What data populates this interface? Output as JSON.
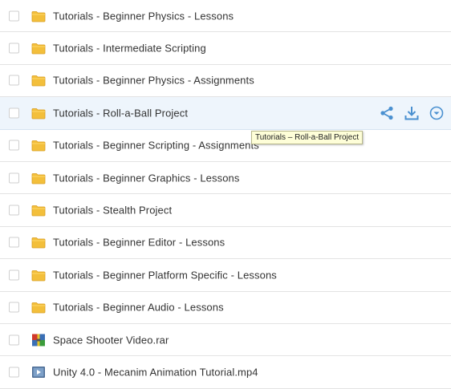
{
  "files": [
    {
      "name": "Tutorials - Beginner Physics - Lessons",
      "type": "folder-icon"
    },
    {
      "name": "Tutorials - Intermediate Scripting",
      "type": "folder-icon"
    },
    {
      "name": "Tutorials - Beginner Physics - Assignments",
      "type": "folder-icon"
    },
    {
      "name": "Tutorials - Roll-a-Ball Project",
      "type": "folder-icon",
      "hovered": true
    },
    {
      "name": "Tutorials - Beginner Scripting - Assignments",
      "type": "folder-icon"
    },
    {
      "name": "Tutorials - Beginner Graphics - Lessons",
      "type": "folder-icon"
    },
    {
      "name": "Tutorials - Stealth Project",
      "type": "folder-icon"
    },
    {
      "name": "Tutorials - Beginner Editor - Lessons",
      "type": "folder-icon"
    },
    {
      "name": "Tutorials - Beginner Platform Specific - Lessons",
      "type": "folder-icon"
    },
    {
      "name": "Tutorials - Beginner Audio - Lessons",
      "type": "folder-icon"
    },
    {
      "name": "Space Shooter Video.rar",
      "type": "archive-icon"
    },
    {
      "name": "Unity 4.0 - Mecanim Animation Tutorial.mp4",
      "type": "video-icon"
    }
  ],
  "row_actions": [
    "share-icon",
    "download-icon",
    "more-options-icon"
  ],
  "tooltip": "Tutorials – Roll-a-Ball Project",
  "colors": {
    "accent": "#4a90d0",
    "folder": "#f3bf3b",
    "hover_row": "#eef5fc"
  }
}
